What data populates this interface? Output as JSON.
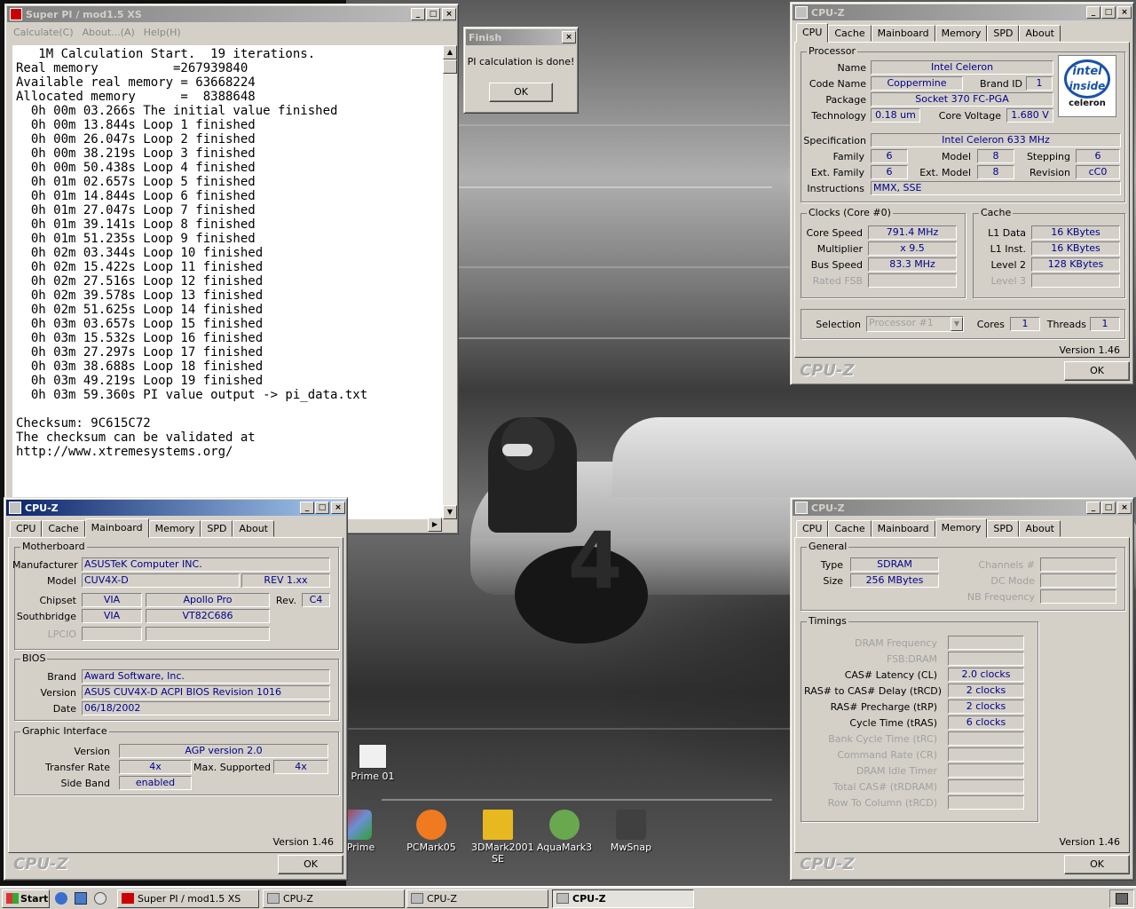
{
  "superpi": {
    "title": "Super PI / mod1.5 XS",
    "menu": [
      "Calculate(C)",
      "About...(A)",
      "Help(H)"
    ],
    "lines": [
      "   1M Calculation Start.  19 iterations.",
      "Real memory          =267939840",
      "Available real memory = 63668224",
      "Allocated memory      =  8388648",
      "  0h 00m 03.266s The initial value finished",
      "  0h 00m 13.844s Loop 1 finished",
      "  0h 00m 26.047s Loop 2 finished",
      "  0h 00m 38.219s Loop 3 finished",
      "  0h 00m 50.438s Loop 4 finished",
      "  0h 01m 02.657s Loop 5 finished",
      "  0h 01m 14.844s Loop 6 finished",
      "  0h 01m 27.047s Loop 7 finished",
      "  0h 01m 39.141s Loop 8 finished",
      "  0h 01m 51.235s Loop 9 finished",
      "  0h 02m 03.344s Loop 10 finished",
      "  0h 02m 15.422s Loop 11 finished",
      "  0h 02m 27.516s Loop 12 finished",
      "  0h 02m 39.578s Loop 13 finished",
      "  0h 02m 51.625s Loop 14 finished",
      "  0h 03m 03.657s Loop 15 finished",
      "  0h 03m 15.532s Loop 16 finished",
      "  0h 03m 27.297s Loop 17 finished",
      "  0h 03m 38.688s Loop 18 finished",
      "  0h 03m 49.219s Loop 19 finished",
      "  0h 03m 59.360s PI value output -> pi_data.txt",
      "",
      "Checksum: 9C615C72",
      "The checksum can be validated at",
      "http://www.xtremesystems.org/"
    ]
  },
  "finish": {
    "title": "Finish",
    "message": "PI calculation is done!",
    "ok": "OK"
  },
  "cpuz_cpu": {
    "title": "CPU-Z",
    "tabs": [
      "CPU",
      "Cache",
      "Mainboard",
      "Memory",
      "SPD",
      "About"
    ],
    "processor_group": "Processor",
    "name_lbl": "Name",
    "name": "Intel Celeron",
    "codename_lbl": "Code Name",
    "codename": "Coppermine",
    "brandid_lbl": "Brand ID",
    "brandid": "1",
    "package_lbl": "Package",
    "package": "Socket 370 FC-PGA",
    "tech_lbl": "Technology",
    "tech": "0.18 um",
    "voltage_lbl": "Core Voltage",
    "voltage": "1.680 V",
    "spec_lbl": "Specification",
    "spec": "Intel Celeron 633 MHz",
    "family_lbl": "Family",
    "family": "6",
    "model_lbl": "Model",
    "model": "8",
    "stepping_lbl": "Stepping",
    "stepping": "6",
    "extfamily_lbl": "Ext. Family",
    "extfamily": "6",
    "extmodel_lbl": "Ext. Model",
    "extmodel": "8",
    "revision_lbl": "Revision",
    "revision": "cC0",
    "instr_lbl": "Instructions",
    "instr": "MMX, SSE",
    "clocks_group": "Clocks (Core #0)",
    "corespeed_lbl": "Core Speed",
    "corespeed": "791.4 MHz",
    "mult_lbl": "Multiplier",
    "mult": "x 9.5",
    "bus_lbl": "Bus Speed",
    "bus": "83.3 MHz",
    "ratedfsb_lbl": "Rated FSB",
    "cache_group": "Cache",
    "l1d_lbl": "L1 Data",
    "l1d": "16 KBytes",
    "l1i_lbl": "L1 Inst.",
    "l1i": "16 KBytes",
    "l2_lbl": "Level 2",
    "l2": "128 KBytes",
    "l3_lbl": "Level 3",
    "selection_lbl": "Selection",
    "selection": "Processor #1",
    "cores_lbl": "Cores",
    "cores": "1",
    "threads_lbl": "Threads",
    "threads": "1",
    "version": "Version 1.46",
    "brand": "CPU-Z",
    "ok": "OK",
    "logo_top": "intel",
    "logo_mid": "inside",
    "logo_bottom": "celeron"
  },
  "cpuz_mb": {
    "title": "CPU-Z",
    "tabs": [
      "CPU",
      "Cache",
      "Mainboard",
      "Memory",
      "SPD",
      "About"
    ],
    "mb_group": "Motherboard",
    "mfr_lbl": "Manufacturer",
    "mfr": "ASUSTeK Computer INC.",
    "model_lbl": "Model",
    "model": "CUV4X-D",
    "rev": "REV 1.xx",
    "chipset_lbl": "Chipset",
    "chipset_vendor": "VIA",
    "chipset": "Apollo Pro",
    "chipset_rev_lbl": "Rev.",
    "chipset_rev": "C4",
    "south_lbl": "Southbridge",
    "south_vendor": "VIA",
    "south": "VT82C686",
    "lpcio_lbl": "LPCIO",
    "bios_group": "BIOS",
    "brand_lbl": "Brand",
    "bios_brand": "Award Software, Inc.",
    "version_lbl": "Version",
    "bios_version": "ASUS CUV4X-D ACPI BIOS Revision 1016",
    "date_lbl": "Date",
    "bios_date": "06/18/2002",
    "gi_group": "Graphic Interface",
    "gi_version_lbl": "Version",
    "gi_version": "AGP version 2.0",
    "rate_lbl": "Transfer Rate",
    "rate": "4x",
    "maxsup_lbl": "Max. Supported",
    "maxsup": "4x",
    "sideband_lbl": "Side Band",
    "sideband": "enabled",
    "version": "Version 1.46",
    "brand": "CPU-Z",
    "ok": "OK"
  },
  "cpuz_mem": {
    "title": "CPU-Z",
    "tabs": [
      "CPU",
      "Cache",
      "Mainboard",
      "Memory",
      "SPD",
      "About"
    ],
    "general_group": "General",
    "type_lbl": "Type",
    "type": "SDRAM",
    "size_lbl": "Size",
    "size": "256 MBytes",
    "channels_lbl": "Channels #",
    "dcmode_lbl": "DC Mode",
    "nbfreq_lbl": "NB Frequency",
    "timings_group": "Timings",
    "dramfreq_lbl": "DRAM Frequency",
    "fsbdram_lbl": "FSB:DRAM",
    "cas_lbl": "CAS# Latency (CL)",
    "cas": "2.0 clocks",
    "trcd_lbl": "RAS# to CAS# Delay (tRCD)",
    "trcd": "2 clocks",
    "trp_lbl": "RAS# Precharge (tRP)",
    "trp": "2 clocks",
    "tras_lbl": "Cycle Time (tRAS)",
    "tras": "6 clocks",
    "trc_lbl": "Bank Cycle Time (tRC)",
    "cr_lbl": "Command Rate (CR)",
    "idle_lbl": "DRAM Idle Timer",
    "trdram_lbl": "Total CAS# (tRDRAM)",
    "rtc_lbl": "Row To Column (tRCD)",
    "version": "Version 1.46",
    "brand": "CPU-Z",
    "ok": "OK"
  },
  "desktop_icons": [
    {
      "label": "Prime 01",
      "color": "#f0f0f0",
      "icon": "window-shortcut-icon"
    },
    {
      "label": "wPrime",
      "color": "#6a8fd6",
      "icon": "wprime-icon"
    },
    {
      "label": "PCMark05",
      "color": "#f07a20",
      "icon": "pcmark-icon"
    },
    {
      "label": "3DMark2001 SE",
      "color": "#e8b820",
      "icon": "3dmark-icon"
    },
    {
      "label": "AquaMark3",
      "color": "#6aa84f",
      "icon": "aquamark-icon"
    },
    {
      "label": "MwSnap",
      "color": "#404040",
      "icon": "camera-icon"
    }
  ],
  "taskbar": {
    "start": "Start",
    "items": [
      "Super PI / mod1.5 XS",
      "CPU-Z",
      "CPU-Z",
      "CPU-Z"
    ]
  }
}
